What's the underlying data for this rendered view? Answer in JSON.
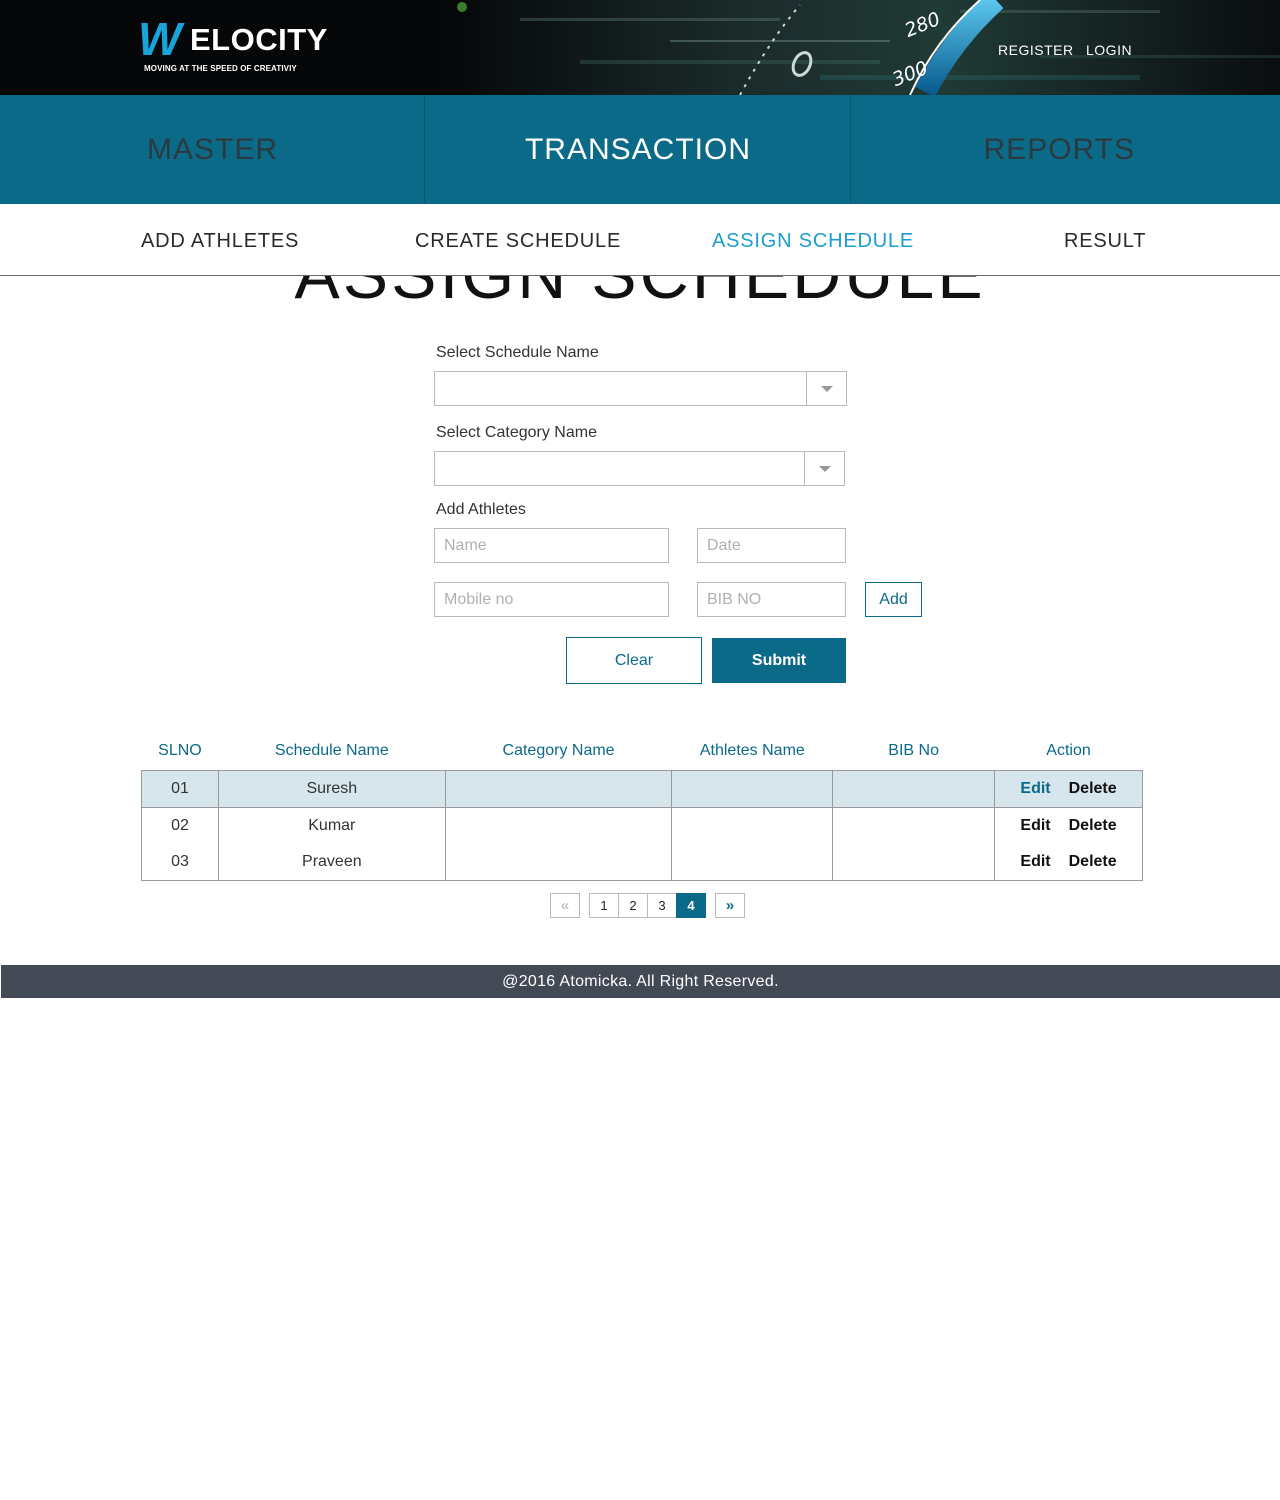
{
  "brand": {
    "logo_mark": "W",
    "name": "ELOCITY",
    "tagline": "MOVING AT THE SPEED OF CREATIVIY",
    "speedometer_labels": [
      "280",
      "300"
    ]
  },
  "header": {
    "register_label": "REGISTER",
    "login_label": "LOGIN"
  },
  "main_nav": {
    "tabs": [
      {
        "label": "MASTER",
        "active": false
      },
      {
        "label": "TRANSACTION",
        "active": true
      },
      {
        "label": "REPORTS",
        "active": false
      }
    ]
  },
  "sub_nav": {
    "items": [
      {
        "label": "ADD ATHLETES",
        "active": false
      },
      {
        "label": "CREATE SCHEDULE",
        "active": false
      },
      {
        "label": "ASSIGN SCHEDULE",
        "active": true
      },
      {
        "label": "RESULT",
        "active": false
      }
    ]
  },
  "page": {
    "title": "ASSIGN SCHEDULE"
  },
  "form": {
    "schedule_label": "Select Schedule Name",
    "schedule_value": "",
    "category_label": "Select Category Name",
    "category_value": "",
    "athletes_label": "Add Athletes",
    "name_placeholder": "Name",
    "date_placeholder": "Date",
    "mobile_placeholder": "Mobile no",
    "bib_placeholder": "BIB NO",
    "add_label": "Add",
    "clear_label": "Clear",
    "submit_label": "Submit"
  },
  "table": {
    "columns": [
      "SLNO",
      "Schedule Name",
      "Category Name",
      "Athletes Name",
      "BIB No",
      "Action"
    ],
    "rows": [
      {
        "slno": "01",
        "schedule": "Suresh",
        "category": "",
        "athlete": "",
        "bib": "",
        "edit": "Edit",
        "delete": "Delete"
      },
      {
        "slno": "02",
        "schedule": "Kumar",
        "category": "",
        "athlete": "",
        "bib": "",
        "edit": "Edit",
        "delete": "Delete"
      },
      {
        "slno": "03",
        "schedule": "Praveen",
        "category": "",
        "athlete": "",
        "bib": "",
        "edit": "Edit",
        "delete": "Delete"
      }
    ]
  },
  "pagination": {
    "prev": "«",
    "pages": [
      "1",
      "2",
      "3",
      "4"
    ],
    "current": "4",
    "next": "»"
  },
  "footer": {
    "text": "@2016 Atomicka. All Right Reserved."
  },
  "colors": {
    "primary": "#0c6a89",
    "accent": "#1a9dd0",
    "header_bg": "#050708",
    "footer_bg": "#434955",
    "row_highlight": "#d6e6ec"
  }
}
